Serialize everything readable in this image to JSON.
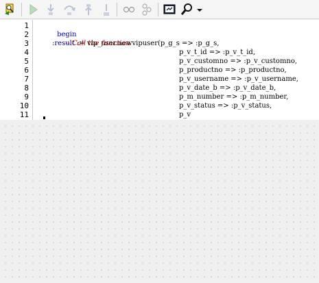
{
  "toolbar": {
    "buttons": [
      {
        "name": "execute-debug-icon",
        "enabled": true
      },
      {
        "name": "run-icon",
        "enabled": false
      },
      {
        "name": "step-into-icon",
        "enabled": false
      },
      {
        "name": "step-over-icon",
        "enabled": false
      },
      {
        "name": "step-out-icon",
        "enabled": false
      },
      {
        "name": "run-to-exception-icon",
        "enabled": false
      },
      {
        "name": "toggle-breakpoint-icon",
        "enabled": false
      },
      {
        "name": "debug-variables-icon",
        "enabled": false
      },
      {
        "name": "show-output-icon",
        "enabled": true
      },
      {
        "name": "find-icon",
        "enabled": true
      },
      {
        "name": "dropdown-arrow-icon",
        "enabled": true
      }
    ]
  },
  "editor": {
    "line_numbers": [
      "1",
      "2",
      "3",
      "4",
      "5",
      "6",
      "7",
      "8",
      "9",
      "10",
      "11"
    ],
    "lines": [
      {
        "keyword": "begin"
      },
      {
        "comment": "-- Call the function"
      },
      {
        "bind": ":result",
        "text": " := vip_user.newvipuser(p_g_s => :p_g_s,"
      },
      {
        "text": "p_v_t_id => :p_v_t_id,"
      },
      {
        "text": "p_v_customno => :p_v_customno,"
      },
      {
        "text": "p_productno => :p_productno,"
      },
      {
        "text": "p_v_username => :p_v_username,"
      },
      {
        "text": "p_v_date_b => :p_v_date_b,"
      },
      {
        "text": "p_m_number => :p_m_number,"
      },
      {
        "text": "p_v_status => :p_v_status,"
      },
      {
        "text": "p_v"
      }
    ]
  },
  "colors": {
    "keyword": "#0000c8",
    "comment": "#c00000",
    "bind_variable": "#000080"
  }
}
